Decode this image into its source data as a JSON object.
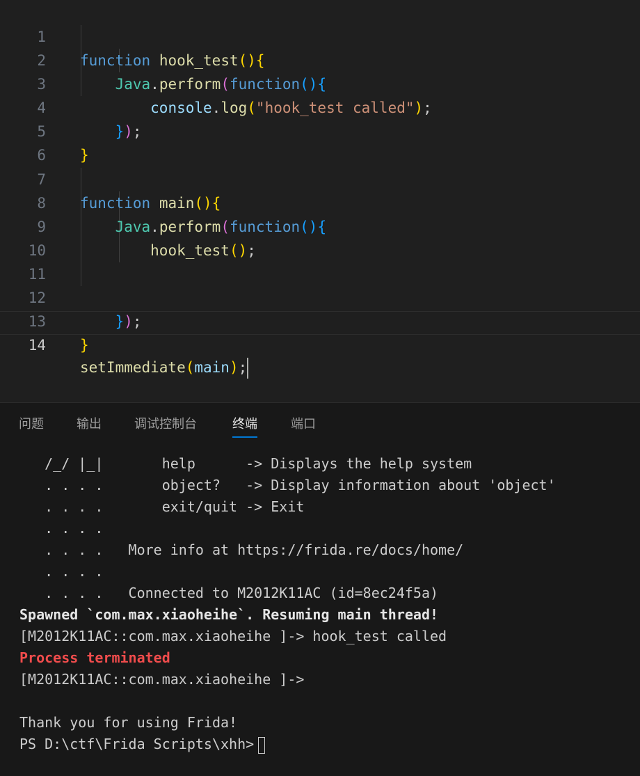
{
  "editor": {
    "line_numbers": [
      "1",
      "2",
      "3",
      "4",
      "5",
      "6",
      "7",
      "8",
      "9",
      "10",
      "11",
      "12",
      "13",
      "14"
    ],
    "active_line": "14",
    "code": {
      "l1": {
        "kw": "function",
        "name": "hook_test",
        "open": "(",
        "close": ")",
        "brace": "{"
      },
      "l2": {
        "obj": "Java",
        "dot": ".",
        "method": "perform",
        "open": "(",
        "kw": "function",
        "p_open": "(",
        "p_close": ")",
        "brace": "{"
      },
      "l3": {
        "obj": "console",
        "dot": ".",
        "method": "log",
        "open": "(",
        "str": "\"hook_test called\"",
        "close": ")",
        "semi": ";"
      },
      "l4": {
        "brace": "}",
        "close": ")",
        "semi": ";"
      },
      "l5": {
        "brace": "}"
      },
      "l7": {
        "kw": "function",
        "name": "main",
        "open": "(",
        "close": ")",
        "brace": "{"
      },
      "l8": {
        "obj": "Java",
        "dot": ".",
        "method": "perform",
        "open": "(",
        "kw": "function",
        "p_open": "(",
        "p_close": ")",
        "brace": "{"
      },
      "l9": {
        "name": "hook_test",
        "open": "(",
        "close": ")",
        "semi": ";"
      },
      "l12": {
        "brace": "}",
        "close": ")",
        "semi": ";"
      },
      "l13": {
        "brace": "}"
      },
      "l14": {
        "name": "setImmediate",
        "open": "(",
        "arg": "main",
        "close": ")",
        "semi": ";"
      }
    }
  },
  "panel": {
    "tabs": [
      {
        "label": "问题"
      },
      {
        "label": "输出"
      },
      {
        "label": "调试控制台"
      },
      {
        "label": "终端"
      },
      {
        "label": "端口"
      }
    ],
    "active_tab": "终端"
  },
  "terminal": {
    "lines": [
      "   /_/ |_|       help      -> Displays the help system",
      "   . . . .       object?   -> Display information about 'object'",
      "   . . . .       exit/quit -> Exit",
      "   . . . .",
      "   . . . .   More info at https://frida.re/docs/home/",
      "   . . . .",
      "   . . . .   Connected to M2012K11AC (id=8ec24f5a)"
    ],
    "spawned": "Spawned `com.max.xiaoheihe`. Resuming main thread!",
    "hook_output": "[M2012K11AC::com.max.xiaoheihe ]-> hook_test called",
    "terminated": "Process terminated",
    "prompt_after": "[M2012K11AC::com.max.xiaoheihe ]->",
    "blank": "",
    "thanks": "Thank you for using Frida!",
    "ps_prompt": "PS D:\\ctf\\Frida Scripts\\xhh>"
  },
  "colors": {
    "editor_bg": "#1f1f1f",
    "panel_bg": "#181818",
    "keyword": "#569cd6",
    "function": "#dcdcaa",
    "string": "#ce9178",
    "error_red": "#f14c4c",
    "tab_underline": "#0078d4"
  }
}
